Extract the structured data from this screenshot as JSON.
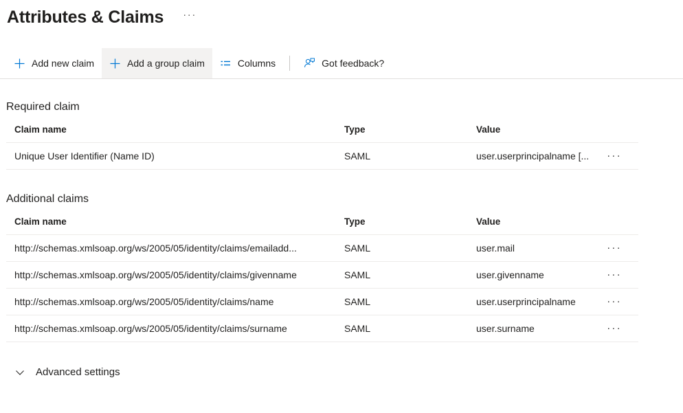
{
  "header": {
    "title": "Attributes & Claims",
    "more_label": "···"
  },
  "toolbar": {
    "add_new_claim": "Add new claim",
    "add_group_claim": "Add a group claim",
    "columns": "Columns",
    "got_feedback": "Got feedback?",
    "accent_color": "#0078d4"
  },
  "required_section": {
    "title": "Required claim",
    "columns": {
      "claim_name": "Claim name",
      "type": "Type",
      "value": "Value"
    },
    "rows": [
      {
        "claim_name": "Unique User Identifier (Name ID)",
        "type": "SAML",
        "value": "user.userprincipalname [...",
        "menu": "···"
      }
    ]
  },
  "additional_section": {
    "title": "Additional claims",
    "columns": {
      "claim_name": "Claim name",
      "type": "Type",
      "value": "Value"
    },
    "rows": [
      {
        "claim_name": "http://schemas.xmlsoap.org/ws/2005/05/identity/claims/emailadd...",
        "type": "SAML",
        "value": "user.mail",
        "menu": "···"
      },
      {
        "claim_name": "http://schemas.xmlsoap.org/ws/2005/05/identity/claims/givenname",
        "type": "SAML",
        "value": "user.givenname",
        "menu": "···"
      },
      {
        "claim_name": "http://schemas.xmlsoap.org/ws/2005/05/identity/claims/name",
        "type": "SAML",
        "value": "user.userprincipalname",
        "menu": "···"
      },
      {
        "claim_name": "http://schemas.xmlsoap.org/ws/2005/05/identity/claims/surname",
        "type": "SAML",
        "value": "user.surname",
        "menu": "···"
      }
    ]
  },
  "advanced": {
    "label": "Advanced settings"
  }
}
